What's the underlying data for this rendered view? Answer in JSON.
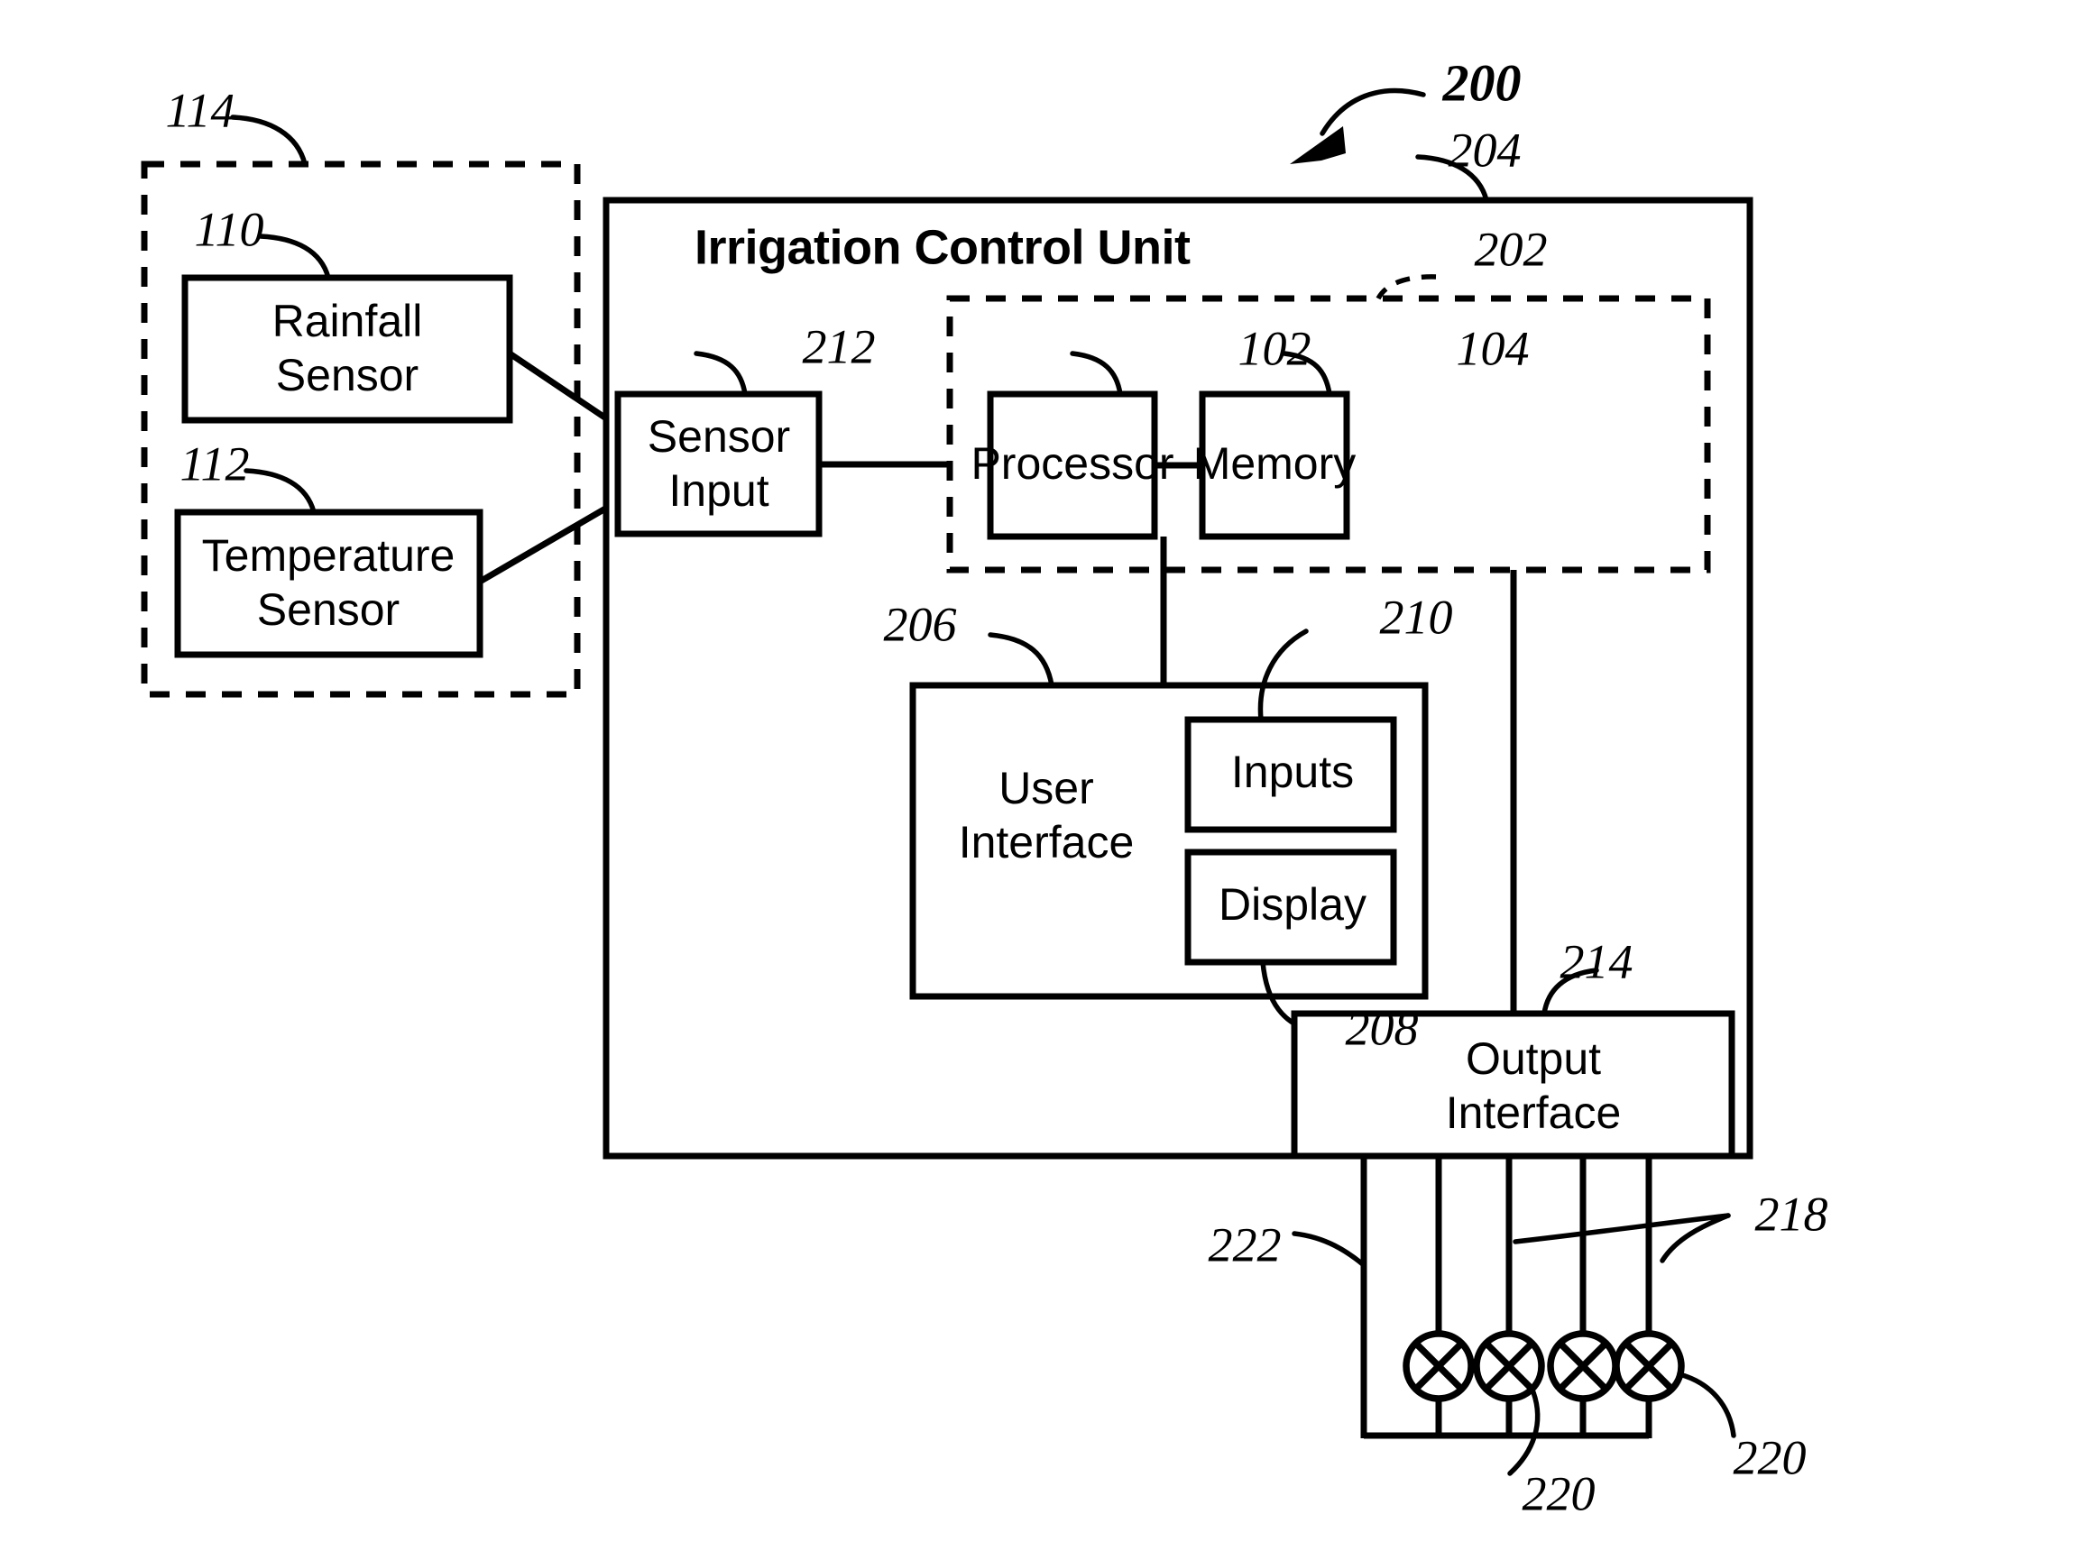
{
  "figure": {
    "title": "Irrigation Control Unit",
    "figure_ref": "200"
  },
  "blocks": {
    "rainfall_sensor": {
      "label_line1": "Rainfall",
      "label_line2": "Sensor",
      "ref": "110"
    },
    "temperature_sensor": {
      "label_line1": "Temperature",
      "label_line2": "Sensor",
      "ref": "112"
    },
    "sensor_group": {
      "ref": "114"
    },
    "sensor_input": {
      "label_line1": "Sensor",
      "label_line2": "Input",
      "ref": "212"
    },
    "control_unit": {
      "label": "Irrigation Control Unit",
      "ref": "204"
    },
    "computing_group": {
      "ref": "202"
    },
    "processor": {
      "label": "Processor",
      "ref": "102"
    },
    "memory": {
      "label": "Memory",
      "ref": "104"
    },
    "user_interface": {
      "label_line1": "User",
      "label_line2": "Interface",
      "ref": "206"
    },
    "inputs": {
      "label": "Inputs",
      "ref": "210"
    },
    "display": {
      "label": "Display",
      "ref": "208"
    },
    "output_interface": {
      "label_line1": "Output",
      "label_line2": "Interface",
      "ref": "214"
    },
    "valve_lines": {
      "ref": "218"
    },
    "common_line": {
      "ref": "222"
    },
    "valve_a": {
      "ref": "220"
    },
    "valve_b": {
      "ref": "220"
    }
  },
  "icons": {
    "valve": "valve-symbol-icon",
    "figure_arrow": "figure-callout-arrow-icon"
  },
  "colors": {
    "stroke": "#000000",
    "background": "#ffffff"
  }
}
